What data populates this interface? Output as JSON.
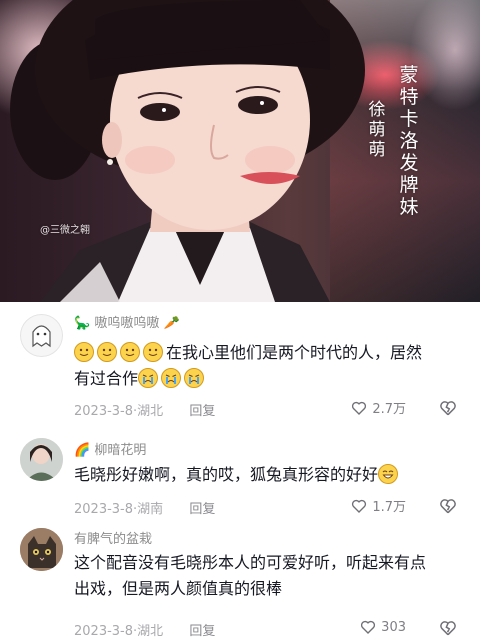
{
  "video": {
    "role_caption": "蒙特卡洛发牌妹",
    "actor_caption": "徐萌萌",
    "watermark": "@三微之翱"
  },
  "comments": [
    {
      "username": "嗷呜嗷呜嗷",
      "username_emoji": [
        "dinosaur-icon",
        "carrot-icon"
      ],
      "text_prefix_emoji": [
        "smile-face",
        "smile-face",
        "smile-face",
        "smile-face"
      ],
      "text_line1": "在我心里他们是两个时代的人，居然",
      "text_line2": "有过合作",
      "text_suffix_emoji": [
        "crying-face",
        "crying-face",
        "crying-face"
      ],
      "date": "2023-3-8",
      "location": "湖北",
      "reply": "回复",
      "likes": "2.7万"
    },
    {
      "username": "柳暗花明",
      "username_emoji": [
        "rainbow-icon"
      ],
      "text": "毛晓彤好嫩啊，真的哎，狐兔真形容的好好",
      "text_suffix_emoji": [
        "grin-face"
      ],
      "date": "2023-3-8",
      "location": "湖南",
      "reply": "回复",
      "likes": "1.7万"
    },
    {
      "username": "有脾气的盆栽",
      "text_line1": "这个配音没有毛晓彤本人的可爱好听，听起来有点",
      "text_line2": "出戏，但是两人颜值真的很棒",
      "date": "2023-3-8",
      "location": "湖北",
      "reply": "回复",
      "likes": "303"
    }
  ],
  "colors": {
    "text": "#161823",
    "meta": "#a8a8ad",
    "username": "#8c8c8c"
  }
}
